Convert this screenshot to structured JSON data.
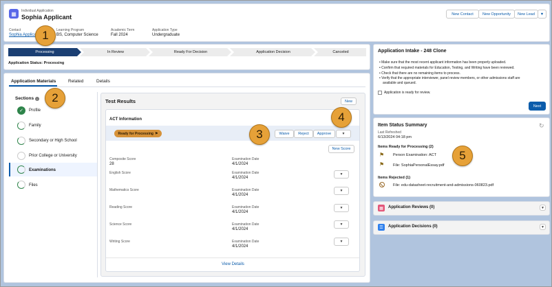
{
  "header": {
    "object_type": "Individual Application",
    "record_name": "Sophia Applicant",
    "buttons": {
      "new_contact": "New Contact",
      "new_opportunity": "New Opportunity",
      "new_lead": "New Lead"
    },
    "fields": [
      {
        "label": "Contact",
        "value": "Sophia Applicant"
      },
      {
        "label": "Learning Program",
        "value": "BS, Computer Science"
      },
      {
        "label": "Academic Term",
        "value": "Fall 2024"
      },
      {
        "label": "Application Type",
        "value": "Undergraduate"
      }
    ]
  },
  "path": {
    "steps": [
      "Processing",
      "In Review",
      "Ready For Decision",
      "Application Decision",
      "Canceled"
    ],
    "status_label": "Application Status: Processing"
  },
  "tabs": [
    "Application Materials",
    "Related",
    "Details"
  ],
  "sections": {
    "title": "Sections",
    "items": [
      "Profile",
      "Family",
      "Secondary or High School",
      "Prior College or University",
      "Examinations",
      "Files"
    ]
  },
  "test_results": {
    "title": "Test Results",
    "new_label": "New",
    "act_title": "ACT Information",
    "status_badge": "Ready for Processing",
    "actions": {
      "waive": "Waive",
      "reject": "Reject",
      "approve": "Approve"
    },
    "new_score_label": "New Score",
    "composite_label": "Composite Score",
    "composite_value": "28",
    "exam_date_label": "Examination Date",
    "exam_date_value": "4/1/2024",
    "scores": [
      "English Score",
      "Mathematics Score",
      "Reading Score",
      "Science Score",
      "Writing Score"
    ],
    "view_details": "View Details"
  },
  "intake": {
    "title": "Application Intake - 248 Clone",
    "bullets": [
      "Make sure that the most recent applicant information has been properly uploaded.",
      "Confirm that required materials for Education, Testing, and Writing have been reviewed.",
      "Check that there are no remaining items to process.",
      "Verify that the appropriate interviewer, panel review members, or other admissions staff are",
      "available and queued."
    ],
    "checkbox_label": "Application is ready for review.",
    "next_label": "Next"
  },
  "item_status": {
    "title": "Item Status Summary",
    "refreshed_label": "Last Refreshed",
    "refreshed_value": "6/13/2024 04:18 pm",
    "ready_heading": "Items Ready for Processing (2)",
    "ready_items": [
      "Person Examination: ACT",
      "File: SophiaPersonalEssay.pdf"
    ],
    "rejected_heading": "Items Rejected (1)",
    "rejected_items": [
      "File: edu-datasheet-recruitment-and-admissions-060823.pdf"
    ]
  },
  "related": {
    "reviews": "Application Reviews (0)",
    "decisions": "Application Decisions (0)"
  },
  "callouts": [
    "1",
    "2",
    "3",
    "4",
    "5"
  ],
  "colors": {
    "brand": "#0b5cab",
    "path_active": "#1b3f73",
    "complete": "#2e844a",
    "callout": "#e6a138"
  }
}
